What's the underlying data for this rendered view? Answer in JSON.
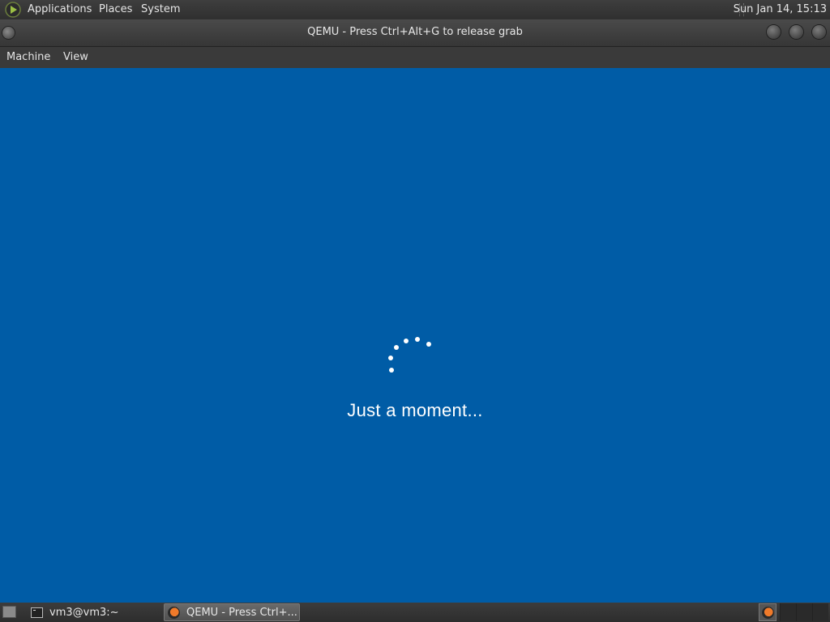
{
  "top_panel": {
    "menus": [
      "Applications",
      "Places",
      "System"
    ],
    "clock": "Sun Jan 14, 15:13"
  },
  "window": {
    "title": "QEMU - Press Ctrl+Alt+G to release grab",
    "menu": [
      "Machine",
      "View"
    ]
  },
  "guest": {
    "message": "Just a moment...",
    "background_color": "#005ca6"
  },
  "taskbar": {
    "tasks": [
      {
        "label": "vm3@vm3:~",
        "icon": "terminal-icon"
      },
      {
        "label": "QEMU - Press Ctrl+...",
        "icon": "qemu-icon",
        "active": true
      }
    ]
  }
}
